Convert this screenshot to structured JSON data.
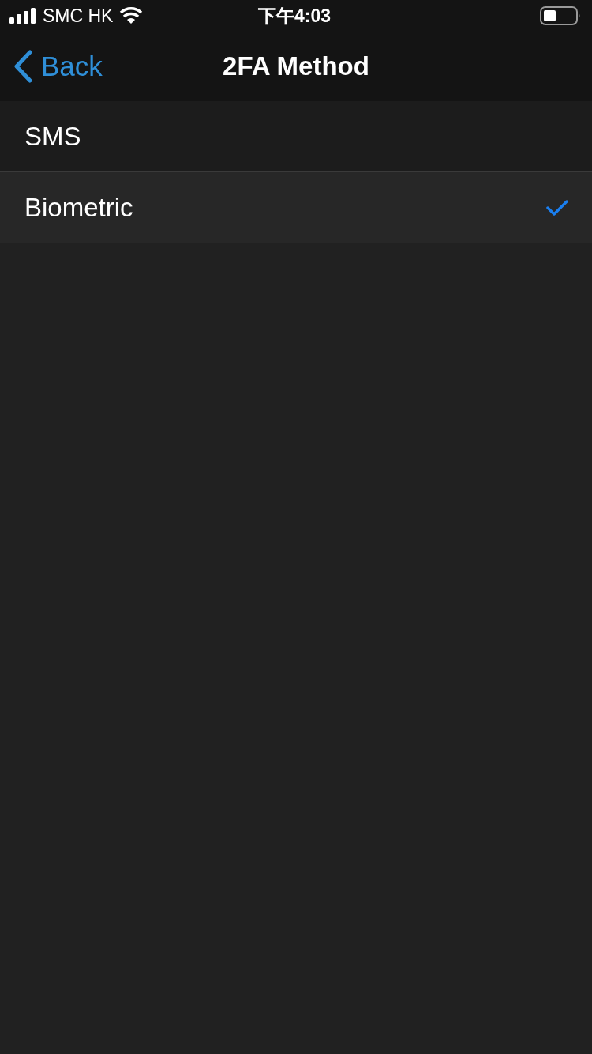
{
  "status_bar": {
    "carrier": "SMC HK",
    "time": "下午4:03"
  },
  "nav_bar": {
    "back_label": "Back",
    "title": "2FA Method"
  },
  "options": [
    {
      "label": "SMS",
      "selected": false
    },
    {
      "label": "Biometric",
      "selected": true
    }
  ]
}
